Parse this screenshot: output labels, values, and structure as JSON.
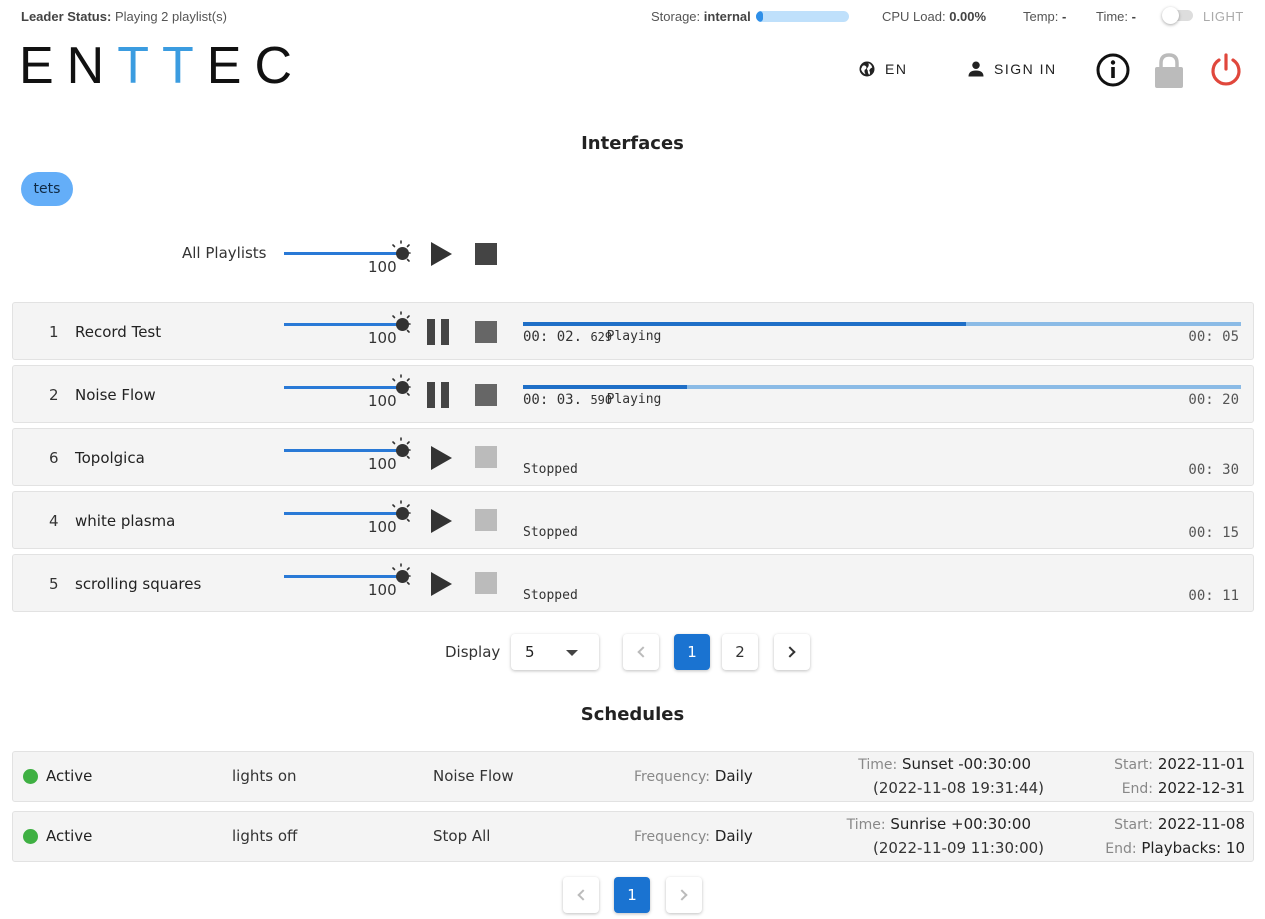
{
  "status": {
    "leader_label": "Leader Status:",
    "leader_value": "Playing 2 playlist(s)",
    "storage_label": "Storage:",
    "storage_value": "internal",
    "storage_fill_fraction": 0.08,
    "cpu_label": "CPU Load:",
    "cpu_value": "0.00%",
    "temp_label": "Temp:",
    "temp_value": "-",
    "time_label": "Time:",
    "time_value": "-",
    "theme_label": "LIGHT"
  },
  "header": {
    "logo_a": "EN",
    "logo_b": "TT",
    "logo_c": "EC",
    "lang_label": "EN",
    "sign_in_label": "SIGN IN"
  },
  "interfaces": {
    "title": "Interfaces",
    "chip_label": "tets",
    "all_label": "All Playlists",
    "all_intensity": "100"
  },
  "playlists": [
    {
      "num": "1",
      "name": "Record Test",
      "intensity": "100",
      "state": "Playing",
      "elapsed_main": "00: 02.",
      "elapsed_ms": "629",
      "total": "00: 05",
      "progress": 0.617
    },
    {
      "num": "2",
      "name": "Noise Flow",
      "intensity": "100",
      "state": "Playing",
      "elapsed_main": "00: 03.",
      "elapsed_ms": "590",
      "total": "00: 20",
      "progress": 0.228
    },
    {
      "num": "6",
      "name": "Topolgica",
      "intensity": "100",
      "state": "Stopped",
      "total": "00: 30"
    },
    {
      "num": "4",
      "name": "white plasma",
      "intensity": "100",
      "state": "Stopped",
      "total": "00: 15"
    },
    {
      "num": "5",
      "name": "scrolling squares",
      "intensity": "100",
      "state": "Stopped",
      "total": "00: 11"
    }
  ],
  "pagination": {
    "display_label": "Display",
    "display_value": "5",
    "pages": [
      "1",
      "2"
    ],
    "current": "1"
  },
  "schedules": {
    "title": "Schedules",
    "rows": [
      {
        "status": "Active",
        "name": "lights on",
        "playlist": "Noise Flow",
        "freq_label": "Frequency:",
        "freq": "Daily",
        "time_label": "Time:",
        "time": "Sunset -00:30:00",
        "time_resolved": "(2022-11-08 19:31:44)",
        "start_label": "Start:",
        "start": "2022-11-01",
        "end_label": "End:",
        "end": "2022-12-31"
      },
      {
        "status": "Active",
        "name": "lights off",
        "playlist": "Stop All",
        "freq_label": "Frequency:",
        "freq": "Daily",
        "time_label": "Time:",
        "time": "Sunrise +00:30:00",
        "time_resolved": "(2022-11-09 11:30:00)",
        "start_label": "Start:",
        "start": "2022-11-08",
        "end_label": "End:",
        "end": "Playbacks: 10"
      }
    ],
    "pages": [
      "1"
    ]
  },
  "colors": {
    "accent": "#1a73d1",
    "slider": "#2979d6",
    "active_dot": "#3fb043",
    "power": "#e0473c",
    "chip": "#64aef8"
  }
}
